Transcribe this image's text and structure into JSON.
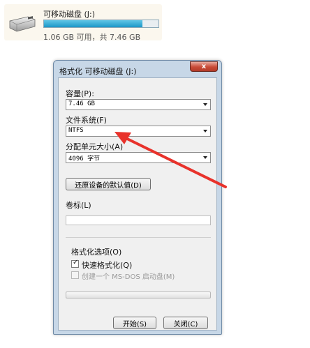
{
  "drive": {
    "name": "可移动磁盘 (J:)",
    "space_text": "1.06 GB 可用，共 7.46 GB",
    "used_fraction": 0.86,
    "icon": "usb-drive-icon"
  },
  "dialog": {
    "title": "格式化 可移动磁盘 (J:)",
    "close_glyph": "x",
    "capacity_label": "容量(P):",
    "capacity_value": "7.46 GB",
    "filesystem_label": "文件系统(F)",
    "filesystem_value": "NTFS",
    "allocation_label": "分配单元大小(A)",
    "allocation_value": "4096 字节",
    "restore_defaults_label": "还原设备的默认值(D)",
    "volume_label": "卷标(L)",
    "volume_value": "",
    "options_label": "格式化选项(O)",
    "quick_format_label": "快速格式化(Q)",
    "quick_format_checked": true,
    "msdos_label": "创建一个 MS-DOS 启动盘(M)",
    "msdos_checked": false,
    "start_label": "开始(S)",
    "close_label": "关闭(C)"
  },
  "colors": {
    "annotation_arrow": "#e8322b",
    "progress_fill": "#1b97c7",
    "title_bar": "#c7d7e7"
  }
}
